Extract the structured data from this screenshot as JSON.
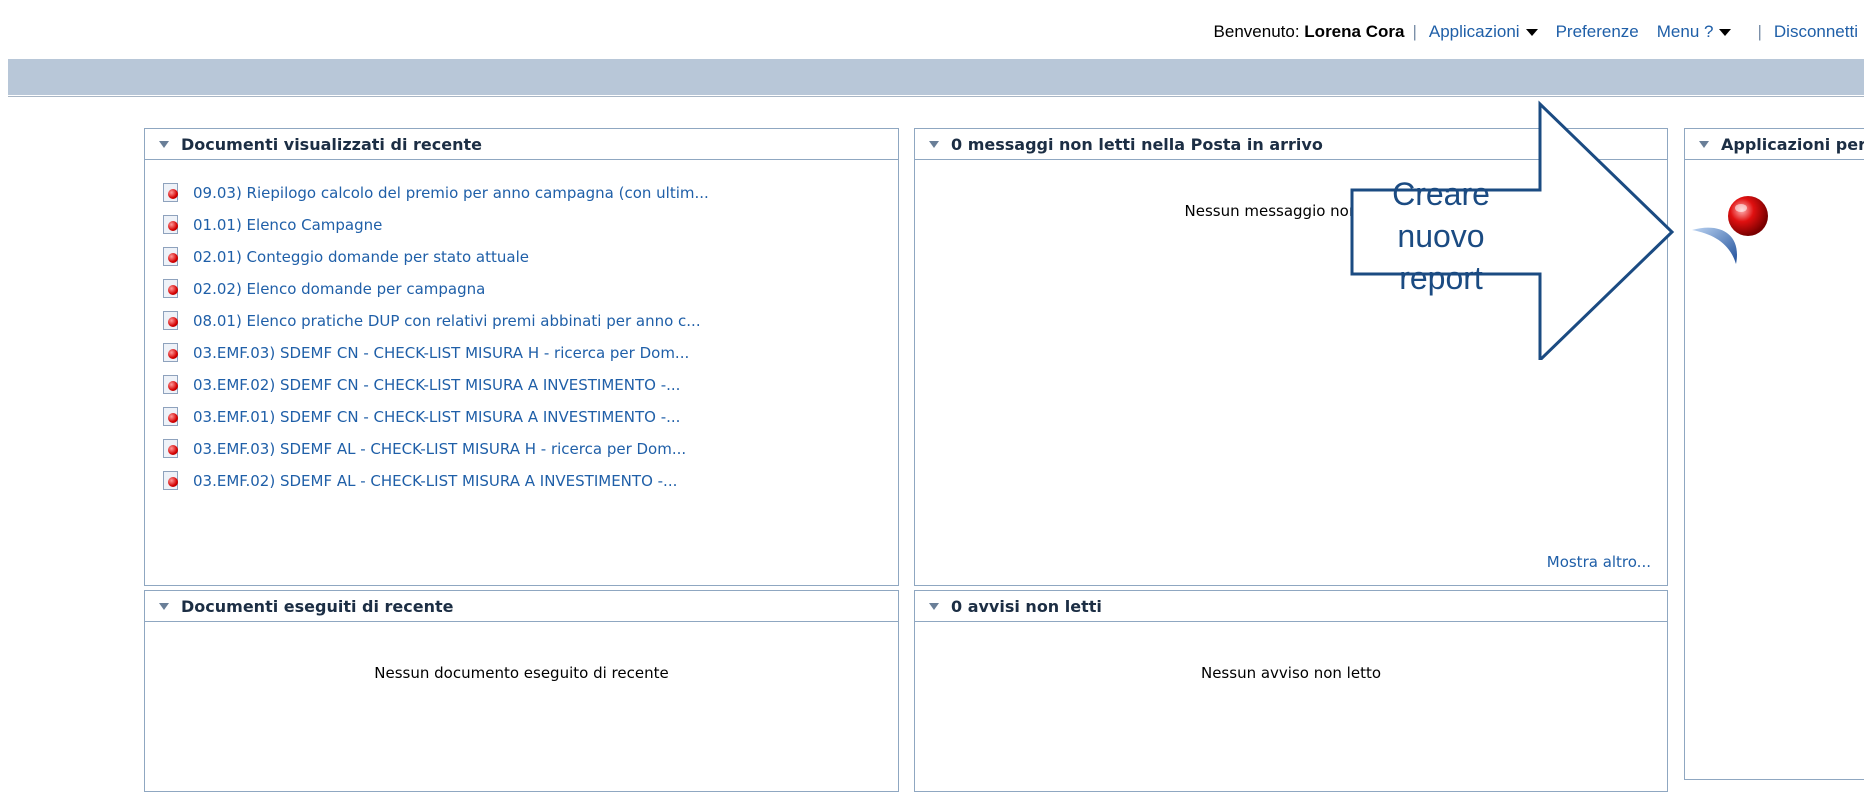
{
  "topbar": {
    "welcome_label": "Benvenuto:",
    "user_name": "Lorena Cora",
    "separator": "|",
    "applications_label": "Applicazioni",
    "preferences_label": "Preferenze",
    "help_label": "Menu ?",
    "logout_label": "Disconnetti"
  },
  "panels": {
    "recent_viewed": {
      "title": "Documenti visualizzati di recente",
      "items": [
        "09.03) Riepilogo calcolo del premio per anno campagna (con ultim...",
        "01.01) Elenco Campagne",
        "02.01) Conteggio domande per stato attuale",
        "02.02) Elenco domande per campagna",
        "08.01) Elenco pratiche DUP con relativi premi abbinati per anno c...",
        "03.EMF.03) SDEMF CN - CHECK-LIST MISURA H - ricerca per Dom...",
        "03.EMF.02) SDEMF CN - CHECK-LIST MISURA A INVESTIMENTO -...",
        "03.EMF.01) SDEMF CN - CHECK-LIST MISURA A INVESTIMENTO -...",
        "03.EMF.03) SDEMF AL - CHECK-LIST MISURA H - ricerca per Dom...",
        "03.EMF.02) SDEMF AL - CHECK-LIST MISURA A INVESTIMENTO -..."
      ]
    },
    "inbox": {
      "title": "0 messaggi non letti nella Posta in arrivo",
      "empty_text": "Nessun messaggio non letto",
      "more_label": "Mostra altro..."
    },
    "personal_apps": {
      "title": "Applicazioni personal"
    },
    "recent_executed": {
      "title": "Documenti eseguiti di recente",
      "empty_text": "Nessun documento eseguito di recente"
    },
    "alerts": {
      "title": "0 avvisi non letti",
      "empty_text": "Nessun avviso non letto"
    }
  },
  "callout": {
    "line1": "Creare nuovo",
    "line2": "report"
  },
  "colors": {
    "link": "#1f5fa8",
    "header_bar": "#b8c7d8",
    "panel_border": "#8fa7c1",
    "callout_border": "#1b4b82"
  }
}
